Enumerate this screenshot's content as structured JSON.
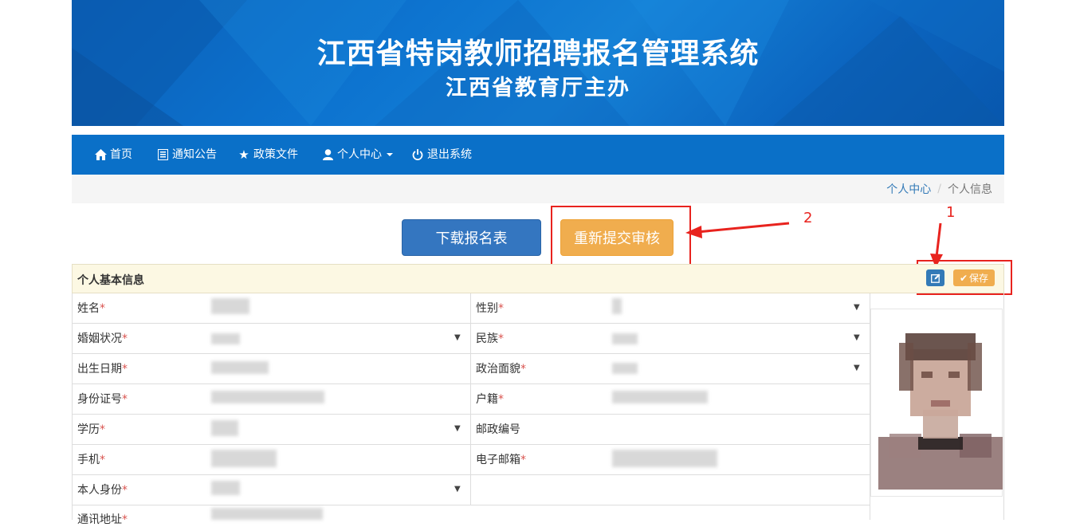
{
  "header": {
    "title": "江西省特岗教师招聘报名管理系统",
    "subtitle": "江西省教育厅主办"
  },
  "nav": {
    "items": [
      {
        "label": "首页",
        "icon": "home-icon"
      },
      {
        "label": "通知公告",
        "icon": "list-icon"
      },
      {
        "label": "政策文件",
        "icon": "star-icon"
      },
      {
        "label": "个人中心",
        "icon": "user-icon"
      },
      {
        "label": "退出系统",
        "icon": "power-icon"
      }
    ]
  },
  "breadcrumb": {
    "parent": "个人中心",
    "separator": "/",
    "current": "个人信息"
  },
  "actions": {
    "download_label": "下载报名表",
    "resubmit_label": "重新提交审核"
  },
  "annotations": {
    "marker_1": "1",
    "marker_2": "2",
    "color": "#e8231e"
  },
  "panel": {
    "title": "个人基本信息",
    "save_label": "保存"
  },
  "form": {
    "required_mark": "*",
    "left": [
      {
        "label": "姓名"
      },
      {
        "label": "婚姻状况"
      },
      {
        "label": "出生日期"
      },
      {
        "label": "身份证号"
      },
      {
        "label": "学历"
      },
      {
        "label": "手机"
      },
      {
        "label": "本人身份"
      },
      {
        "label": "通讯地址"
      }
    ],
    "right": [
      {
        "label": "性别"
      },
      {
        "label": "民族"
      },
      {
        "label": "政治面貌"
      },
      {
        "label": "户籍"
      },
      {
        "label": "邮政编号"
      },
      {
        "label": "电子邮箱"
      }
    ]
  },
  "colors": {
    "nav_bg": "#0a70c8",
    "primary_button": "#3476c0",
    "warning_button": "#f0ad4e",
    "panel_head_bg": "#fcf8e3"
  }
}
